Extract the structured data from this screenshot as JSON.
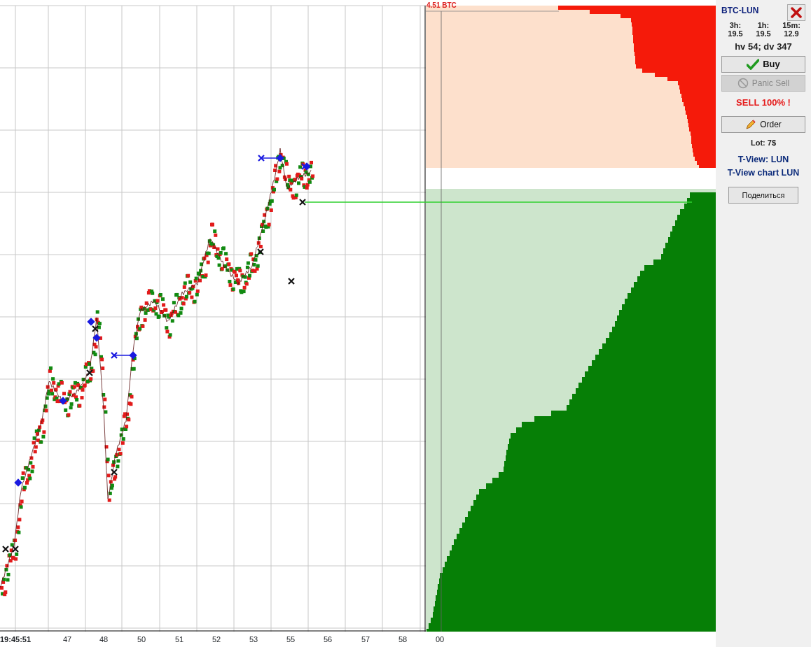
{
  "chart": {
    "time_label": "19:45:51",
    "x_labels": [
      "47",
      "48",
      "50",
      "51",
      "52",
      "53",
      "55",
      "56",
      "57",
      "58"
    ]
  },
  "depth": {
    "label": "4.51 BTC",
    "x_label": "00"
  },
  "panel": {
    "pair": "BTC-LUN",
    "stats": [
      {
        "label": "3h:",
        "value": "19.5"
      },
      {
        "label": "1h:",
        "value": "19.5"
      },
      {
        "label": "15m:",
        "value": "12.9"
      }
    ],
    "volatility": "hv 54; dv 347",
    "items": [
      {
        "kind": "buy",
        "label": "Buy",
        "disabled": false
      },
      {
        "kind": "panic",
        "label": "Panic Sell",
        "disabled": true
      },
      {
        "kind": "alert",
        "label": "SELL 100% !"
      },
      {
        "kind": "order",
        "label": "Order",
        "disabled": false
      },
      {
        "kind": "note",
        "label": "Lot: 7$"
      },
      {
        "kind": "link",
        "label": "T-View: LUN"
      },
      {
        "kind": "link",
        "label": "T-View chart LUN"
      },
      {
        "kind": "share",
        "label": "Поделиться",
        "disabled": false
      }
    ]
  }
}
